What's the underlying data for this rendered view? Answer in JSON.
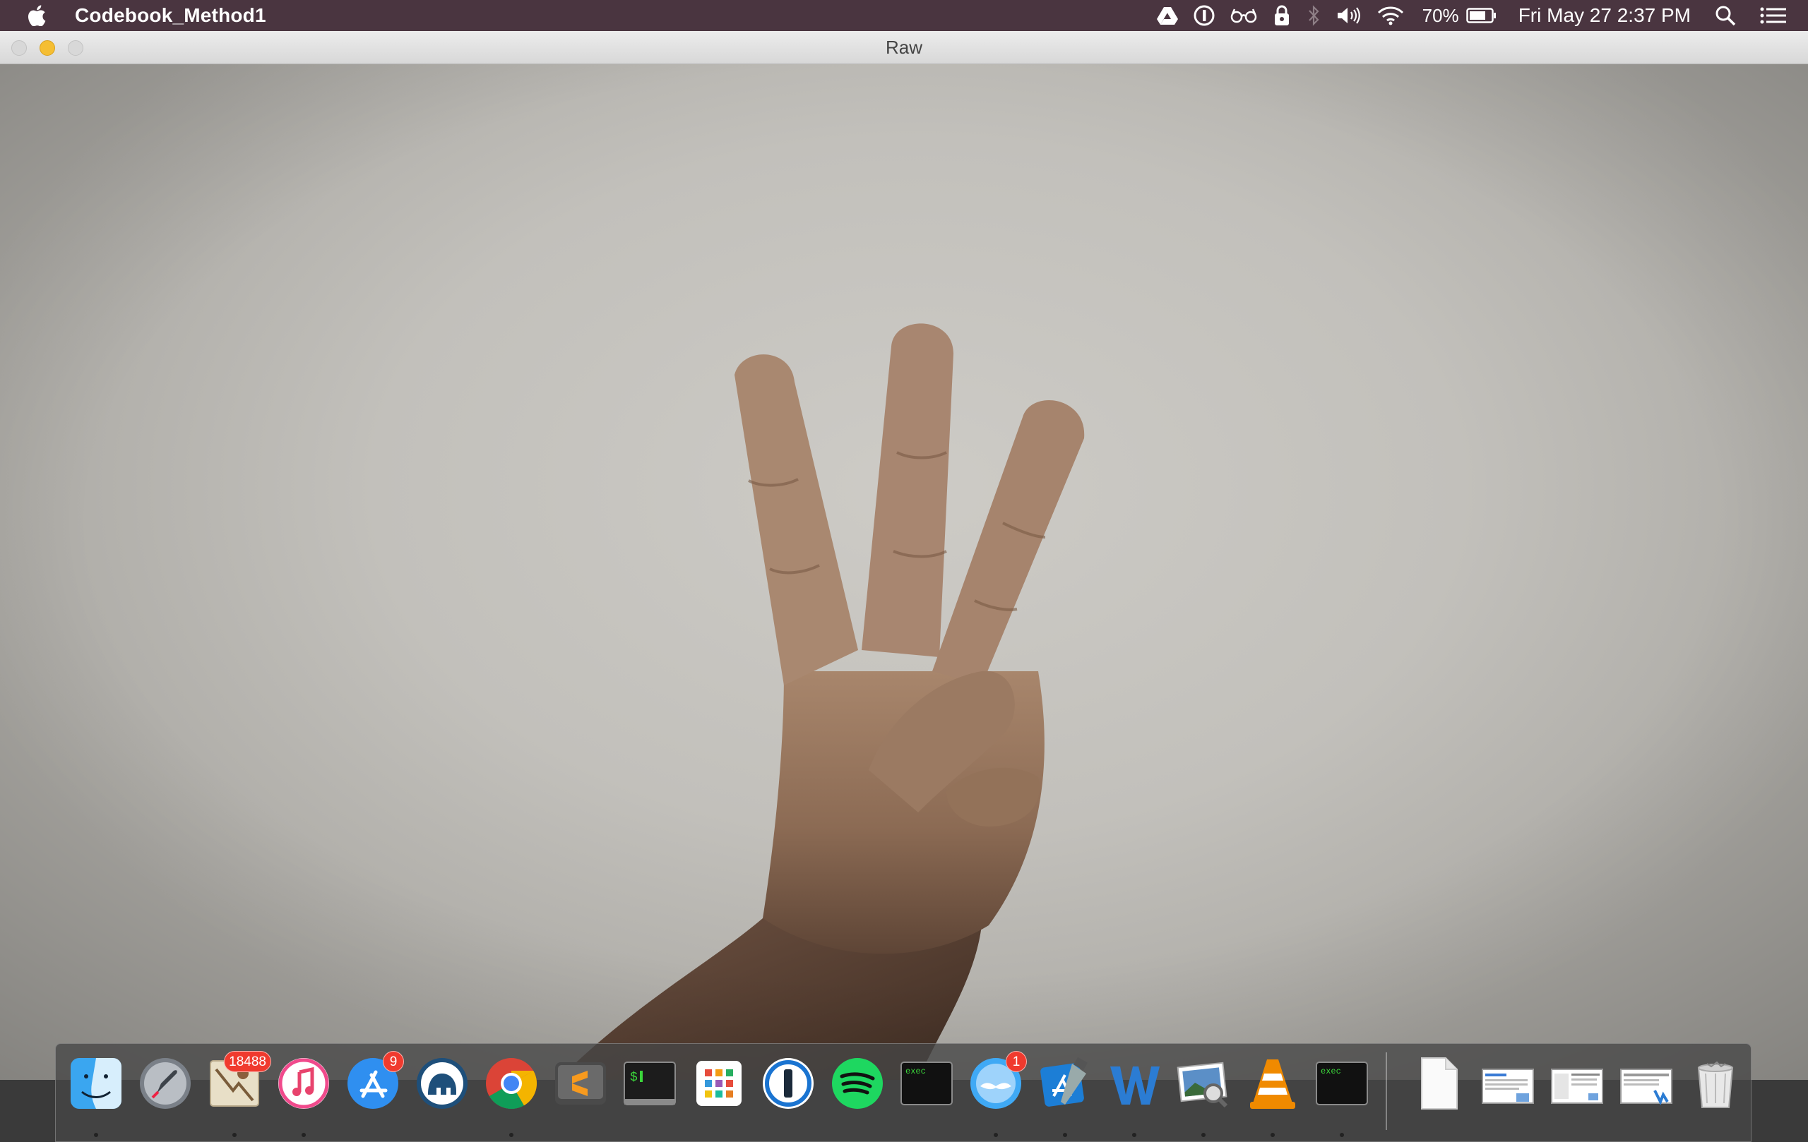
{
  "menubar": {
    "app_name": "Codebook_Method1",
    "battery_percent": "70%",
    "clock": "Fri May 27  2:37 PM",
    "status_icons": [
      "google-drive-icon",
      "1password-icon",
      "glasses-icon",
      "sync-lock-icon",
      "bluetooth-icon",
      "volume-icon",
      "wifi-icon",
      "battery-icon",
      "spotlight-icon",
      "notification-center-icon"
    ]
  },
  "window": {
    "title": "Raw",
    "content": "webcam frame: hand showing three fingers against a light grey wall"
  },
  "dock": {
    "apps": [
      {
        "name": "Finder",
        "icon": "finder-icon",
        "running": true
      },
      {
        "name": "Launchpad",
        "icon": "launchpad-icon",
        "running": false
      },
      {
        "name": "Mail",
        "icon": "mail-icon",
        "badge": "18488",
        "running": true
      },
      {
        "name": "iTunes",
        "icon": "itunes-icon",
        "running": true
      },
      {
        "name": "App Store",
        "icon": "app-store-icon",
        "badge": "9",
        "running": false
      },
      {
        "name": "Sequel Pro",
        "icon": "elephant-icon",
        "running": false
      },
      {
        "name": "Google Chrome",
        "icon": "chrome-icon",
        "running": true
      },
      {
        "name": "Sublime Text",
        "icon": "sublime-icon",
        "running": false
      },
      {
        "name": "Terminal",
        "icon": "terminal-icon",
        "running": false
      },
      {
        "name": "Launcher Grid",
        "icon": "grid-icon",
        "running": false
      },
      {
        "name": "1Password",
        "icon": "1password-icon",
        "running": false
      },
      {
        "name": "Spotify",
        "icon": "spotify-icon",
        "running": false
      },
      {
        "name": "exec",
        "icon": "exec-icon",
        "label": "exec",
        "running": false
      },
      {
        "name": "Tweetbot",
        "icon": "tweetbot-icon",
        "badge": "1",
        "running": true
      },
      {
        "name": "Xcode",
        "icon": "xcode-icon",
        "running": true
      },
      {
        "name": "Word",
        "icon": "word-icon",
        "running": true
      },
      {
        "name": "Preview",
        "icon": "preview-icon",
        "running": true
      },
      {
        "name": "VLC",
        "icon": "vlc-icon",
        "running": true
      },
      {
        "name": "exec",
        "icon": "exec-icon",
        "label": "exec",
        "running": true
      }
    ],
    "documents": [
      {
        "name": "Document",
        "icon": "document-icon"
      },
      {
        "name": "Screenshot 1",
        "icon": "screenshot-icon"
      },
      {
        "name": "Screenshot 2",
        "icon": "screenshot-icon"
      },
      {
        "name": "Screenshot 3",
        "icon": "screenshot-icon"
      },
      {
        "name": "Trash",
        "icon": "trash-icon"
      }
    ]
  }
}
